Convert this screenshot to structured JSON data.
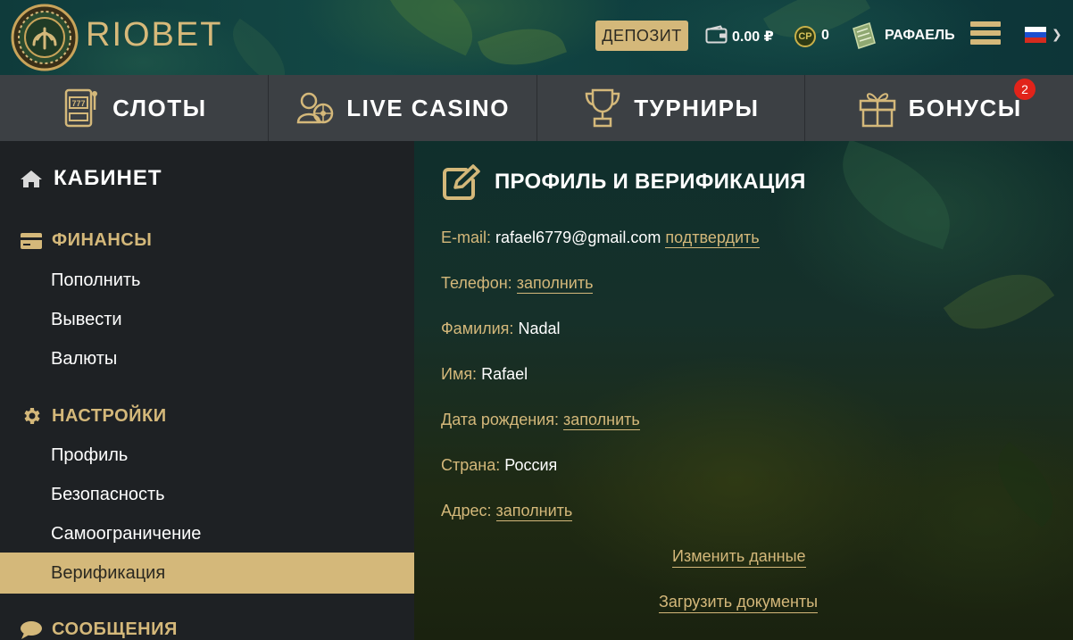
{
  "header": {
    "brand": "RIOBET",
    "deposit_label": "ДЕПОЗИТ",
    "balance": "0.00 ₽",
    "cp_label": "CP",
    "cp_value": "0",
    "user_name": "РАФАЕЛЬ",
    "language": "ru"
  },
  "nav": {
    "items": [
      {
        "label": "СЛОТЫ",
        "icon": "slot-machine-icon"
      },
      {
        "label": "LIVE CASINO",
        "icon": "live-dealer-icon"
      },
      {
        "label": "ТУРНИРЫ",
        "icon": "trophy-icon"
      },
      {
        "label": "БОНУСЫ",
        "icon": "gift-icon",
        "badge": "2"
      }
    ]
  },
  "sidebar": {
    "title": "КАБИНЕТ",
    "finance": {
      "title": "ФИНАНСЫ",
      "items": [
        "Пополнить",
        "Вывести",
        "Валюты"
      ]
    },
    "settings": {
      "title": "НАСТРОЙКИ",
      "items": [
        "Профиль",
        "Безопасность",
        "Самоограничение",
        "Верификация"
      ],
      "active": "Верификация"
    },
    "messages": {
      "title": "СООБЩЕНИЯ"
    }
  },
  "main": {
    "title": "ПРОФИЛЬ И ВЕРИФИКАЦИЯ",
    "fields": {
      "email": {
        "label": "E-mail:",
        "value": "rafael6779@gmail.com",
        "link": "подтвердить"
      },
      "phone": {
        "label": "Телефон:",
        "link": "заполнить"
      },
      "surname": {
        "label": "Фамилия:",
        "value": "Nadal"
      },
      "name": {
        "label": "Имя:",
        "value": "Rafael"
      },
      "birthdate": {
        "label": "Дата рождения:",
        "link": "заполнить"
      },
      "country": {
        "label": "Страна:",
        "value": "Россия"
      },
      "address": {
        "label": "Адрес:",
        "link": "заполнить"
      }
    },
    "edit_label": "Изменить данные",
    "upload_label": "Загрузить документы"
  },
  "colors": {
    "accent": "#d4b87a",
    "nav_bg": "#3c4044",
    "sidebar_bg": "#1e2124",
    "badge": "#e2231a"
  }
}
